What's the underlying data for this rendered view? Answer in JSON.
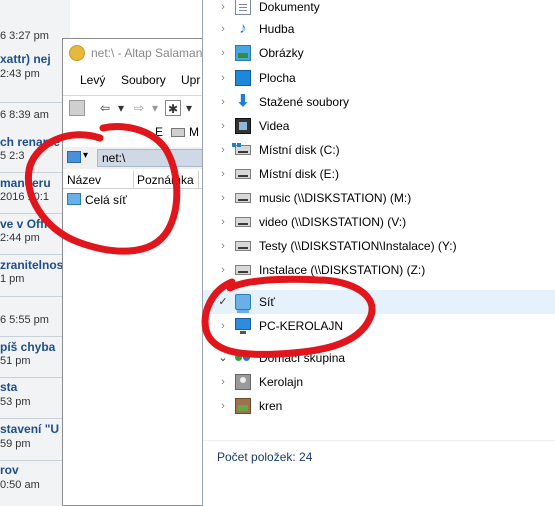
{
  "forum": {
    "items": [
      {
        "text": "6 3:27 pm",
        "kind": "meta"
      },
      {
        "text": "xattr) nej",
        "kind": "title"
      },
      {
        "text": "2:43 pm",
        "kind": "meta"
      },
      {
        "text": "6 8:39 am",
        "kind": "meta"
      },
      {
        "text": "ch rename",
        "kind": "title"
      },
      {
        "text": "5 2:3",
        "kind": "meta"
      },
      {
        "text": "manderu",
        "kind": "title"
      },
      {
        "text": "2016 10:1",
        "kind": "meta"
      },
      {
        "text": "ve v Offic",
        "kind": "title"
      },
      {
        "text": "2:44 pm",
        "kind": "meta"
      },
      {
        "text": "zranitelnos",
        "kind": "title"
      },
      {
        "text": "1 pm",
        "kind": "meta"
      },
      {
        "text": "6 5:55 pm",
        "kind": "meta"
      },
      {
        "text": "píš chyba",
        "kind": "title"
      },
      {
        "text": "51 pm",
        "kind": "meta"
      },
      {
        "text": "sta",
        "kind": "title"
      },
      {
        "text": "53 pm",
        "kind": "meta"
      },
      {
        "text": "stavení \"U",
        "kind": "title"
      },
      {
        "text": "59 pm",
        "kind": "meta"
      },
      {
        "text": "rov",
        "kind": "title"
      },
      {
        "text": "0:50 am",
        "kind": "meta"
      }
    ]
  },
  "salamander": {
    "title": "net:\\ - Altap Salaman",
    "menu": [
      "Levý",
      "Soubory",
      "Upr"
    ],
    "drive_labels": [
      "E",
      "M"
    ],
    "path": "net:\\",
    "columns": [
      "Název",
      "Poznámka"
    ],
    "rows": [
      {
        "name": "Celá síť"
      }
    ]
  },
  "explorer": {
    "items": [
      {
        "label": "Dokumenty",
        "icon": "documents-icon",
        "chevron": "›"
      },
      {
        "label": "Hudba",
        "icon": "music-icon",
        "chevron": "›"
      },
      {
        "label": "Obrázky",
        "icon": "pictures-icon",
        "chevron": "›"
      },
      {
        "label": "Plocha",
        "icon": "desktop-icon",
        "chevron": "›"
      },
      {
        "label": "Stažené soubory",
        "icon": "downloads-icon",
        "chevron": "›"
      },
      {
        "label": "Videa",
        "icon": "videos-icon",
        "chevron": "›"
      },
      {
        "label": "Místní disk (C:)",
        "icon": "system-drive-icon",
        "chevron": "›"
      },
      {
        "label": "Místní disk (E:)",
        "icon": "drive-icon",
        "chevron": "›"
      },
      {
        "label": "music (\\\\DISKSTATION) (M:)",
        "icon": "network-drive-icon",
        "chevron": "›"
      },
      {
        "label": "video (\\\\DISKSTATION) (V:)",
        "icon": "network-drive-icon",
        "chevron": "›"
      },
      {
        "label": "Testy (\\\\DISKSTATION\\Instalace) (Y:)",
        "icon": "network-drive-icon",
        "chevron": "›"
      },
      {
        "label": "Instalace (\\\\DISKSTATION) (Z:)",
        "icon": "network-drive-icon",
        "chevron": "›"
      },
      {
        "label": "Síť",
        "icon": "network-icon",
        "chevron": "✓",
        "selected": true
      },
      {
        "label": "PC-KEROLAJN",
        "icon": "computer-icon",
        "chevron": "›"
      },
      {
        "label": "Domácí skupina",
        "icon": "homegroup-icon",
        "chevron": "⌄"
      },
      {
        "label": "Kerolajn",
        "icon": "user-icon",
        "chevron": "›"
      },
      {
        "label": "kren",
        "icon": "user-picture-icon",
        "chevron": "›"
      }
    ],
    "status": "Počet položek: 24"
  },
  "colors": {
    "marker": "#e0161c",
    "selection": "#e5f1fb",
    "forum_link": "#1e4e8c"
  }
}
